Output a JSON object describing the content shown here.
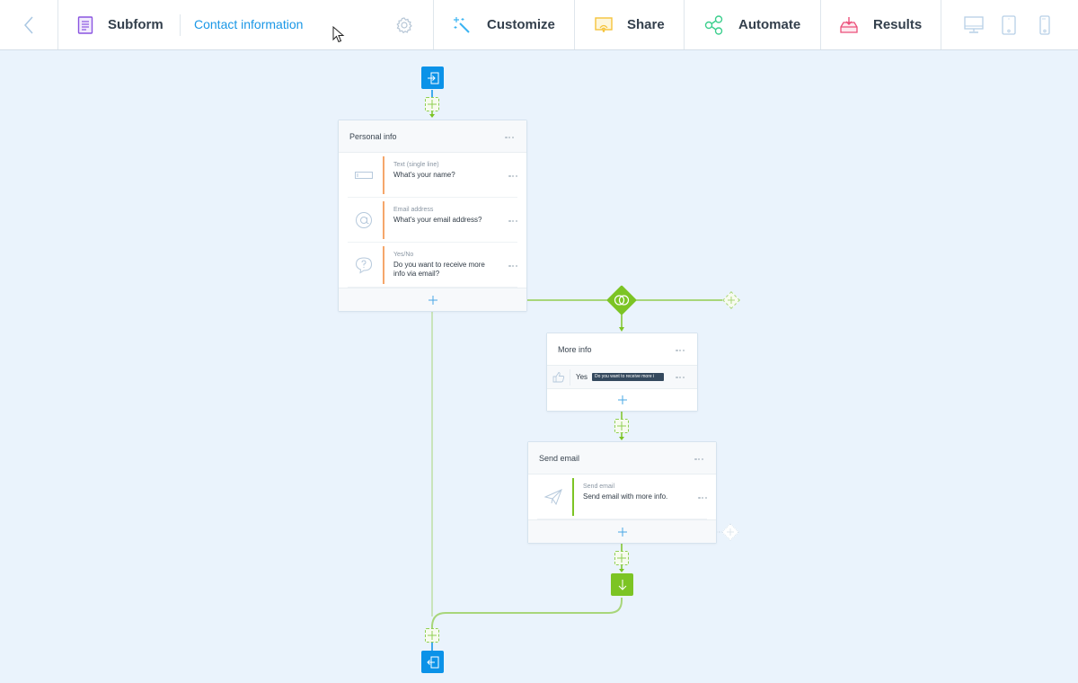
{
  "topbar": {
    "back_icon": "chevron-left-icon",
    "subform_label": "Subform",
    "subform_icon": "document-icon",
    "form_name": "Contact information",
    "settings_icon": "gear-icon",
    "tabs": [
      {
        "label": "Customize",
        "icon": "magic-wand-icon",
        "color": "#3bb4f2"
      },
      {
        "label": "Share",
        "icon": "share-screen-icon",
        "color": "#f5c33b"
      },
      {
        "label": "Automate",
        "icon": "workflow-icon",
        "color": "#3dcf8e"
      },
      {
        "label": "Results",
        "icon": "inbox-download-icon",
        "color": "#ec4f7a"
      }
    ],
    "devices": [
      {
        "name": "desktop",
        "icon": "desktop-icon"
      },
      {
        "name": "tablet",
        "icon": "tablet-icon"
      },
      {
        "name": "mobile",
        "icon": "mobile-icon"
      }
    ]
  },
  "flow": {
    "start_icon": "enter-icon",
    "end_icon": "exit-icon",
    "personal_info": {
      "title": "Personal info",
      "questions": [
        {
          "type": "Text (single line)",
          "text": "What's your name?",
          "icon": "text-field-icon"
        },
        {
          "type": "Email address",
          "text": "What's your email address?",
          "icon": "at-sign-icon"
        },
        {
          "type": "Yes/No",
          "text": "Do you want to receive more info via email?",
          "icon": "question-bubble-icon"
        }
      ]
    },
    "branch_icon": "branch-icon",
    "more_info": {
      "title": "More info",
      "condition_value": "Yes",
      "condition_tag": "Do you want to receive more i",
      "condition_icon": "thumbs-up-icon"
    },
    "send_email": {
      "title": "Send email",
      "action_type": "Send email",
      "action_text": "Send email with more info.",
      "icon": "paper-plane-icon"
    },
    "join_icon": "arrow-down-icon"
  },
  "colors": {
    "accent_blue": "#0b92e8",
    "flow_green": "#7cc424",
    "question_bar": "#f5a66b"
  }
}
